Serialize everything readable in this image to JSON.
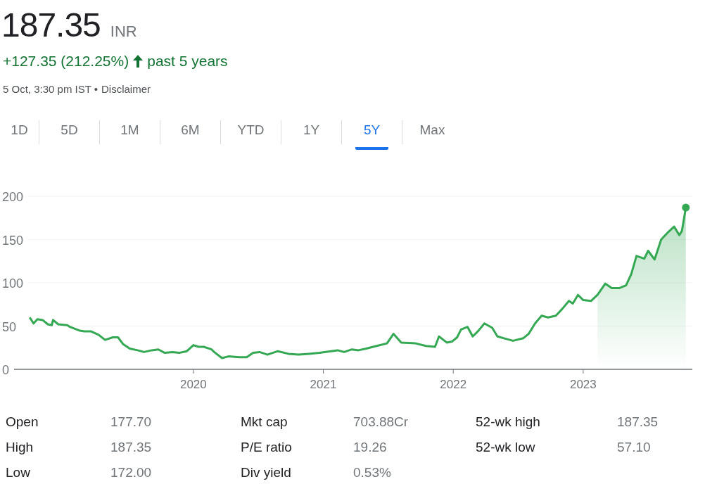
{
  "quote": {
    "price": "187.35",
    "currency": "INR",
    "change": "+127.35 (212.25%)",
    "period": "past 5 years",
    "timestamp": "5 Oct, 3:30 pm IST •",
    "disclaimer": "Disclaimer"
  },
  "tabs": [
    {
      "label": "1D",
      "selected": false
    },
    {
      "label": "5D",
      "selected": false
    },
    {
      "label": "1M",
      "selected": false
    },
    {
      "label": "6M",
      "selected": false
    },
    {
      "label": "YTD",
      "selected": false
    },
    {
      "label": "1Y",
      "selected": false
    },
    {
      "label": "5Y",
      "selected": true
    },
    {
      "label": "Max",
      "selected": false
    }
  ],
  "chart": {
    "chart_data": {
      "type": "line",
      "grid": true,
      "xlim": [
        2018.62,
        2023.84
      ],
      "ylim": [
        0,
        200
      ],
      "yticks": [
        0,
        50,
        100,
        150,
        200
      ],
      "xticks": [
        2020,
        2021,
        2022,
        2023
      ],
      "x": [
        2018.74,
        2018.77,
        2018.8,
        2018.84,
        2018.88,
        2018.91,
        2018.92,
        2018.96,
        2019.03,
        2019.05,
        2019.12,
        2019.16,
        2019.21,
        2019.27,
        2019.32,
        2019.38,
        2019.42,
        2019.46,
        2019.51,
        2019.57,
        2019.62,
        2019.68,
        2019.73,
        2019.78,
        2019.84,
        2019.89,
        2019.95,
        2020.0,
        2020.04,
        2020.08,
        2020.14,
        2020.16,
        2020.22,
        2020.27,
        2020.35,
        2020.41,
        2020.46,
        2020.51,
        2020.57,
        2020.65,
        2020.73,
        2020.81,
        2020.89,
        2020.97,
        2021.06,
        2021.11,
        2021.16,
        2021.22,
        2021.27,
        2021.33,
        2021.41,
        2021.49,
        2021.54,
        2021.6,
        2021.71,
        2021.79,
        2021.86,
        2021.89,
        2021.95,
        2021.99,
        2022.03,
        2022.06,
        2022.11,
        2022.15,
        2022.19,
        2022.24,
        2022.3,
        2022.34,
        2022.41,
        2022.46,
        2022.54,
        2022.58,
        2022.63,
        2022.68,
        2022.73,
        2022.79,
        2022.84,
        2022.89,
        2022.92,
        2022.96,
        2023.0,
        2023.06,
        2023.11,
        2023.17,
        2023.22,
        2023.28,
        2023.33,
        2023.37,
        2023.41,
        2023.47,
        2023.5,
        2023.55,
        2023.6,
        2023.65,
        2023.7,
        2023.74,
        2023.76,
        2023.79
      ],
      "series": [
        {
          "color": "#34a853",
          "values": [
            60,
            53,
            58,
            57,
            52,
            51,
            57,
            52,
            51,
            49,
            45,
            44,
            44,
            40,
            34,
            37,
            37,
            29,
            24,
            22,
            20,
            22,
            23,
            19,
            20,
            19,
            21,
            28,
            26,
            26,
            23,
            20,
            13,
            15,
            14,
            14,
            19,
            20,
            17,
            21,
            18,
            17,
            18,
            19,
            21,
            22,
            20,
            23,
            22,
            24,
            27,
            30,
            41,
            31,
            30,
            27,
            26,
            38,
            31,
            32,
            37,
            46,
            49,
            38,
            44,
            53,
            48,
            38,
            35,
            33,
            36,
            41,
            53,
            62,
            60,
            62,
            70,
            79,
            76,
            86,
            80,
            79,
            86,
            99,
            94,
            94,
            97,
            110,
            131,
            128,
            137,
            127,
            150,
            158,
            165,
            155,
            160,
            187
          ]
        }
      ]
    }
  },
  "stats": [
    [
      {
        "label": "Open",
        "value": "177.70"
      },
      {
        "label": "High",
        "value": "187.35"
      },
      {
        "label": "Low",
        "value": "172.00"
      }
    ],
    [
      {
        "label": "Mkt cap",
        "value": "703.88Cr"
      },
      {
        "label": "P/E ratio",
        "value": "19.26"
      },
      {
        "label": "Div yield",
        "value": "0.53%"
      }
    ],
    [
      {
        "label": "52-wk high",
        "value": "187.35"
      },
      {
        "label": "52-wk low",
        "value": "57.10"
      }
    ]
  ]
}
